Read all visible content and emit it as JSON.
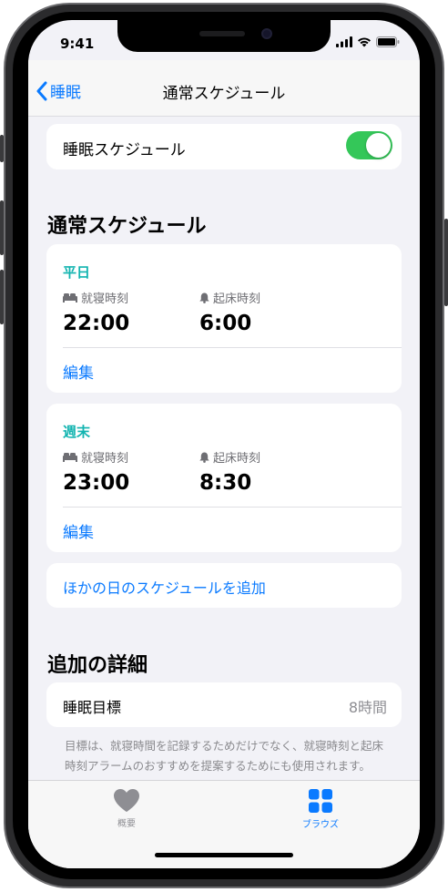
{
  "status_bar": {
    "time": "9:41"
  },
  "nav": {
    "back_label": "睡眠",
    "title": "通常スケジュール"
  },
  "sleep_schedule": {
    "label": "睡眠スケジュール",
    "enabled": true
  },
  "regular_schedule": {
    "heading": "通常スケジュール",
    "weekday": {
      "title": "平日",
      "bedtime_label": "就寝時刻",
      "bedtime": "22:00",
      "wakeup_label": "起床時刻",
      "wakeup": "6:00",
      "edit_label": "編集"
    },
    "weekend": {
      "title": "週末",
      "bedtime_label": "就寝時刻",
      "bedtime": "23:00",
      "wakeup_label": "起床時刻",
      "wakeup": "8:30",
      "edit_label": "編集"
    },
    "add_schedule_label": "ほかの日のスケジュールを追加"
  },
  "details": {
    "heading": "追加の詳細",
    "sleep_goal_label": "睡眠目標",
    "sleep_goal_value": "8時間",
    "footnote": "目標は、就寝時間を記録するためだけでなく、就寝時刻と起床時刻アラームのおすすめを提案するためにも使用されます。"
  },
  "tab_bar": {
    "summary_label": "概要",
    "browse_label": "ブラウズ"
  },
  "colors": {
    "accent": "#0a7aff",
    "schedule_title": "#12b4b0",
    "toggle_on": "#34c759",
    "tab_inactive": "#8e8e93"
  }
}
